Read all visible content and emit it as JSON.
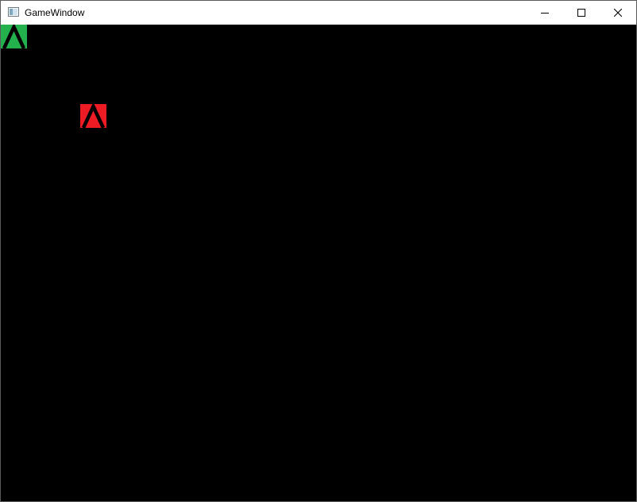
{
  "window": {
    "title": "GameWindow",
    "icon": "app-window-icon",
    "controls": [
      "minimize-icon",
      "maximize-icon",
      "close-icon"
    ]
  },
  "game": {
    "background_color": "#000000",
    "entities": [
      {
        "role": "player",
        "color": "#22b14c",
        "icon": "up-arrow-tank-icon",
        "direction": "up"
      },
      {
        "role": "enemy",
        "color": "#ed1c24",
        "icon": "up-arrow-tank-icon",
        "direction": "up"
      }
    ]
  }
}
